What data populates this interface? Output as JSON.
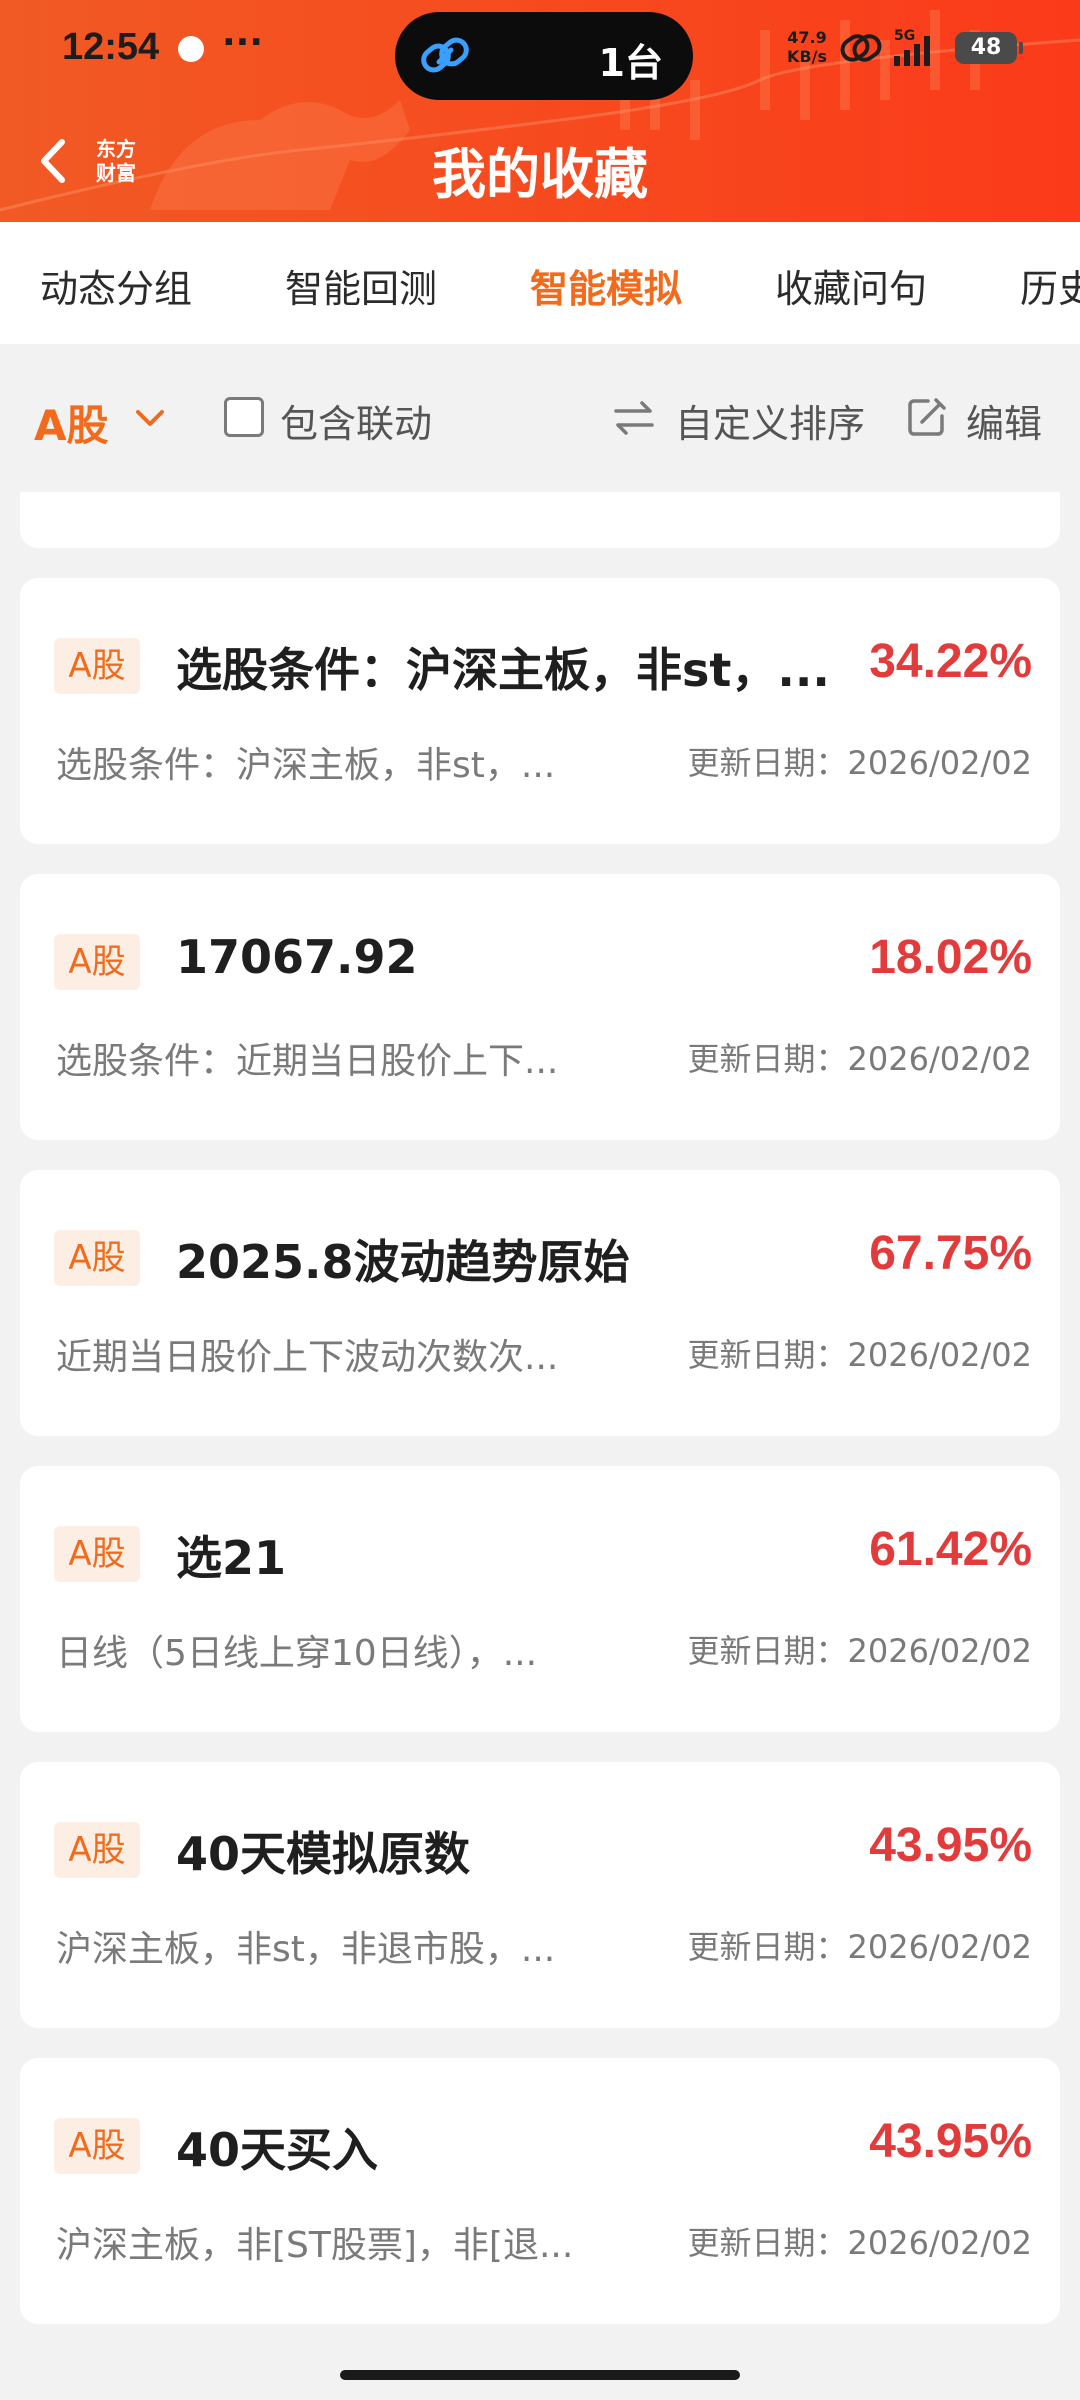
{
  "status_bar": {
    "time": "12:54",
    "more": "···",
    "cast_text": "1台",
    "net_speed_value": "47.9",
    "net_speed_unit": "KB/s",
    "network_type": "5G",
    "battery": "48"
  },
  "header": {
    "brand_line1": "东方",
    "brand_line2": "财富",
    "title": "我的收藏"
  },
  "tabs": [
    {
      "label": "动态分组",
      "active": false
    },
    {
      "label": "智能回测",
      "active": false
    },
    {
      "label": "智能模拟",
      "active": true
    },
    {
      "label": "收藏问句",
      "active": false
    },
    {
      "label": "历史",
      "active": false
    }
  ],
  "filter": {
    "market": "A股",
    "include_linked_label": "包含联动",
    "include_linked_checked": false,
    "sort_label": "自定义排序",
    "edit_label": "编辑"
  },
  "items": [
    {
      "badge": "A股",
      "title": "选股条件：沪深主板，非st，...",
      "return": "34.22%",
      "desc": "选股条件：沪深主板，非st，...",
      "date": "更新日期：2026/02/02"
    },
    {
      "badge": "A股",
      "title": "17067.92",
      "return": "18.02%",
      "desc": "选股条件：近期当日股价上下...",
      "date": "更新日期：2026/02/02"
    },
    {
      "badge": "A股",
      "title": "2025.8波动趋势原始",
      "return": "67.75%",
      "desc": "近期当日股价上下波动次数次...",
      "date": "更新日期：2026/02/02"
    },
    {
      "badge": "A股",
      "title": "选21",
      "return": "61.42%",
      "desc": "日线（5日线上穿10日线），...",
      "date": "更新日期：2026/02/02"
    },
    {
      "badge": "A股",
      "title": "40天模拟原数",
      "return": "43.95%",
      "desc": "沪深主板，非st，非退市股，...",
      "date": "更新日期：2026/02/02"
    },
    {
      "badge": "A股",
      "title": "40天买入",
      "return": "43.95%",
      "desc": "沪深主板，非[ST股票]，非[退...",
      "date": "更新日期：2026/02/02"
    }
  ],
  "colors": {
    "accent": "#f26b1d",
    "header_bg": "#f7491e",
    "return_red": "#e23b3b"
  }
}
